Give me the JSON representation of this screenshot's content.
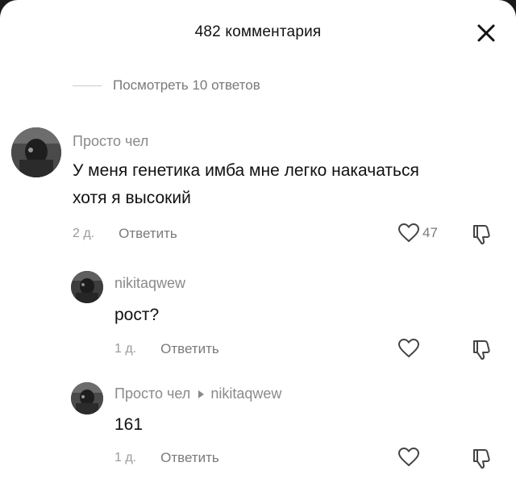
{
  "header": {
    "title": "482 комментария",
    "close_icon": "close-icon"
  },
  "view_replies": {
    "label": "Посмотреть 10 ответов"
  },
  "comments": [
    {
      "username": "Просто чел",
      "text_line1": "У меня генетика имба мне легко накачаться",
      "text_line2": "хотя я высокий",
      "date": "2 д.",
      "reply_label": "Ответить",
      "like_count": "47"
    },
    {
      "username": "nikitaqwew",
      "text": "рост?",
      "date": "1 д.",
      "reply_label": "Ответить"
    },
    {
      "username": "Просто чел",
      "reply_to": "nikitaqwew",
      "text": "161",
      "date": "1 д.",
      "reply_label": "Ответить"
    }
  ],
  "colors": {
    "text_primary": "#111111",
    "text_secondary": "#7a7a7a",
    "background": "#ffffff"
  }
}
